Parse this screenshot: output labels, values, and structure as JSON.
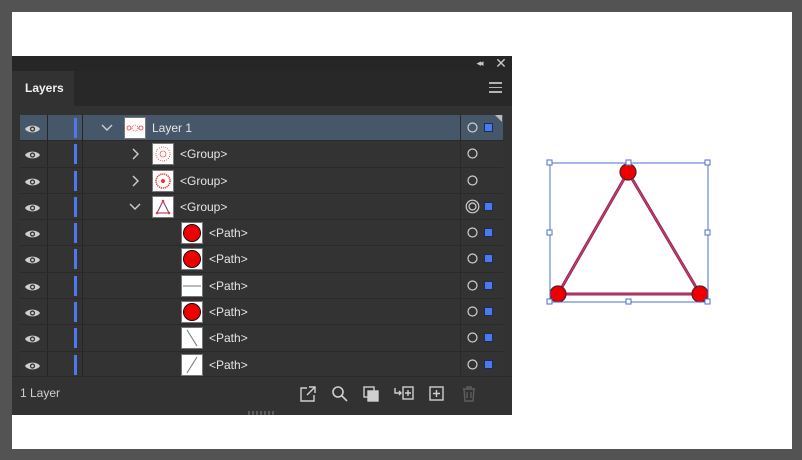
{
  "panel": {
    "tab_label": "Layers",
    "footer": {
      "layer_count": "1 Layer"
    },
    "rows": [
      {
        "name": "row-layer-1",
        "label": "Layer 1",
        "chevron": "down",
        "selected": true,
        "target": "circle",
        "selection_square": true,
        "thumb": "layer"
      },
      {
        "name": "row-group-1",
        "label": "<Group>",
        "chevron": "right",
        "selected": false,
        "target": "circle",
        "selection_square": false,
        "thumb": "group-dots"
      },
      {
        "name": "row-group-2",
        "label": "<Group>",
        "chevron": "right",
        "selected": false,
        "target": "circle",
        "selection_square": false,
        "thumb": "group-ring"
      },
      {
        "name": "row-group-3",
        "label": "<Group>",
        "chevron": "down",
        "selected": false,
        "target": "double-circle",
        "selection_square": true,
        "thumb": "triangle"
      },
      {
        "name": "row-path-1",
        "label": "<Path>",
        "chevron": null,
        "selected": false,
        "target": "circle",
        "selection_square": true,
        "thumb": "red-circle"
      },
      {
        "name": "row-path-2",
        "label": "<Path>",
        "chevron": null,
        "selected": false,
        "target": "circle",
        "selection_square": true,
        "thumb": "red-circle"
      },
      {
        "name": "row-path-3",
        "label": "<Path>",
        "chevron": null,
        "selected": false,
        "target": "circle",
        "selection_square": true,
        "thumb": "h-line"
      },
      {
        "name": "row-path-4",
        "label": "<Path>",
        "chevron": null,
        "selected": false,
        "target": "circle",
        "selection_square": true,
        "thumb": "red-circle"
      },
      {
        "name": "row-path-5",
        "label": "<Path>",
        "chevron": null,
        "selected": false,
        "target": "circle",
        "selection_square": true,
        "thumb": "diag-down"
      },
      {
        "name": "row-path-6",
        "label": "<Path>",
        "chevron": null,
        "selected": false,
        "target": "circle",
        "selection_square": true,
        "thumb": "diag-up"
      }
    ]
  },
  "icons": {
    "footer_buttons": [
      "export-icon",
      "locate-object-icon",
      "clipping-mask-icon",
      "new-sublayer-icon",
      "new-layer-icon",
      "trash-icon"
    ]
  },
  "colors": {
    "layer_color": "#4e79ee",
    "selection_blue": "#4a6fd0",
    "shape_red": "#ee0000",
    "shape_stroke": "#8a2a5a"
  }
}
